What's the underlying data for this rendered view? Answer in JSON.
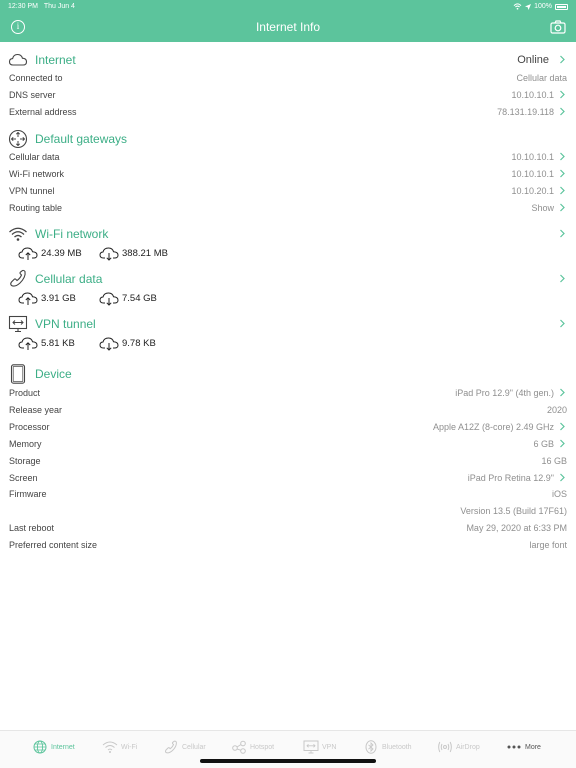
{
  "status_bar": {
    "time": "12:30 PM",
    "date": "Thu Jun 4",
    "battery": "100%"
  },
  "nav": {
    "title": "Internet Info"
  },
  "internet": {
    "title": "Internet",
    "value": "Online",
    "rows": [
      {
        "label": "Connected to",
        "value": "Cellular data"
      },
      {
        "label": "DNS server",
        "value": "10.10.10.1"
      },
      {
        "label": "External address",
        "value": "78.131.19.118"
      }
    ]
  },
  "gateways": {
    "title": "Default gateways",
    "rows": [
      {
        "label": "Cellular data",
        "value": "10.10.10.1"
      },
      {
        "label": "Wi-Fi network",
        "value": "10.10.10.1"
      },
      {
        "label": "VPN tunnel",
        "value": "10.10.20.1"
      },
      {
        "label": "Routing table",
        "value": "Show"
      }
    ]
  },
  "wifi": {
    "title": "Wi-Fi network",
    "upload": "24.39 MB",
    "download": "388.21 MB"
  },
  "cellular": {
    "title": "Cellular data",
    "upload": "3.91 GB",
    "download": "7.54 GB"
  },
  "vpn": {
    "title": "VPN tunnel",
    "upload": "5.81 KB",
    "download": "9.78 KB"
  },
  "device": {
    "title": "Device",
    "rows": [
      {
        "label": "Product",
        "value": "iPad Pro 12.9\" (4th gen.)"
      },
      {
        "label": "Release year",
        "value": "2020"
      },
      {
        "label": "Processor",
        "value": "Apple A12Z (8-core) 2.49 GHz"
      },
      {
        "label": "Memory",
        "value": "6 GB"
      },
      {
        "label": "Storage",
        "value": "16 GB"
      },
      {
        "label": "Screen",
        "value": "iPad Pro Retina 12.9\""
      },
      {
        "label": "Firmware",
        "value": "iOS"
      },
      {
        "label": "",
        "value": "Version 13.5 (Build 17F61)"
      },
      {
        "label": "Last reboot",
        "value": "May 29, 2020 at 6:33 PM"
      },
      {
        "label": "Preferred content size",
        "value": "large font"
      }
    ]
  },
  "tabs": [
    {
      "label": "Internet",
      "icon": "globe-icon"
    },
    {
      "label": "Wi-Fi",
      "icon": "wifi-icon"
    },
    {
      "label": "Cellular",
      "icon": "phone-icon"
    },
    {
      "label": "Hotspot",
      "icon": "hotspot-icon"
    },
    {
      "label": "VPN",
      "icon": "vpn-icon"
    },
    {
      "label": "Bluetooth",
      "icon": "bluetooth-icon"
    },
    {
      "label": "AirDrop",
      "icon": "airdrop-icon"
    },
    {
      "label": "More",
      "icon": "more-icon"
    }
  ],
  "colors": {
    "accent": "#5cc49c",
    "accent_text": "#3cae86"
  }
}
